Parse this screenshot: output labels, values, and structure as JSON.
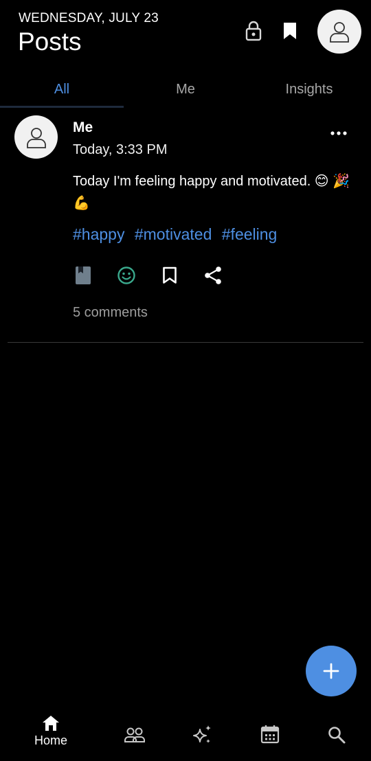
{
  "header": {
    "date": "WEDNESDAY, JULY 23",
    "title": "Posts"
  },
  "tabs": [
    {
      "label": "All",
      "active": true
    },
    {
      "label": "Me",
      "active": false
    },
    {
      "label": "Insights",
      "active": false
    }
  ],
  "post": {
    "author": "Me",
    "time": "Today, 3:33 PM",
    "body": "Today I'm feeling happy and motivated. 😊 🎉💪",
    "tags": [
      "#happy",
      "#motivated",
      "#feeling"
    ],
    "comments": "5 comments"
  },
  "nav": {
    "home_label": "Home"
  },
  "colors": {
    "accent": "#4e8fe2",
    "background": "#000000",
    "muted": "#9e9e9e"
  }
}
